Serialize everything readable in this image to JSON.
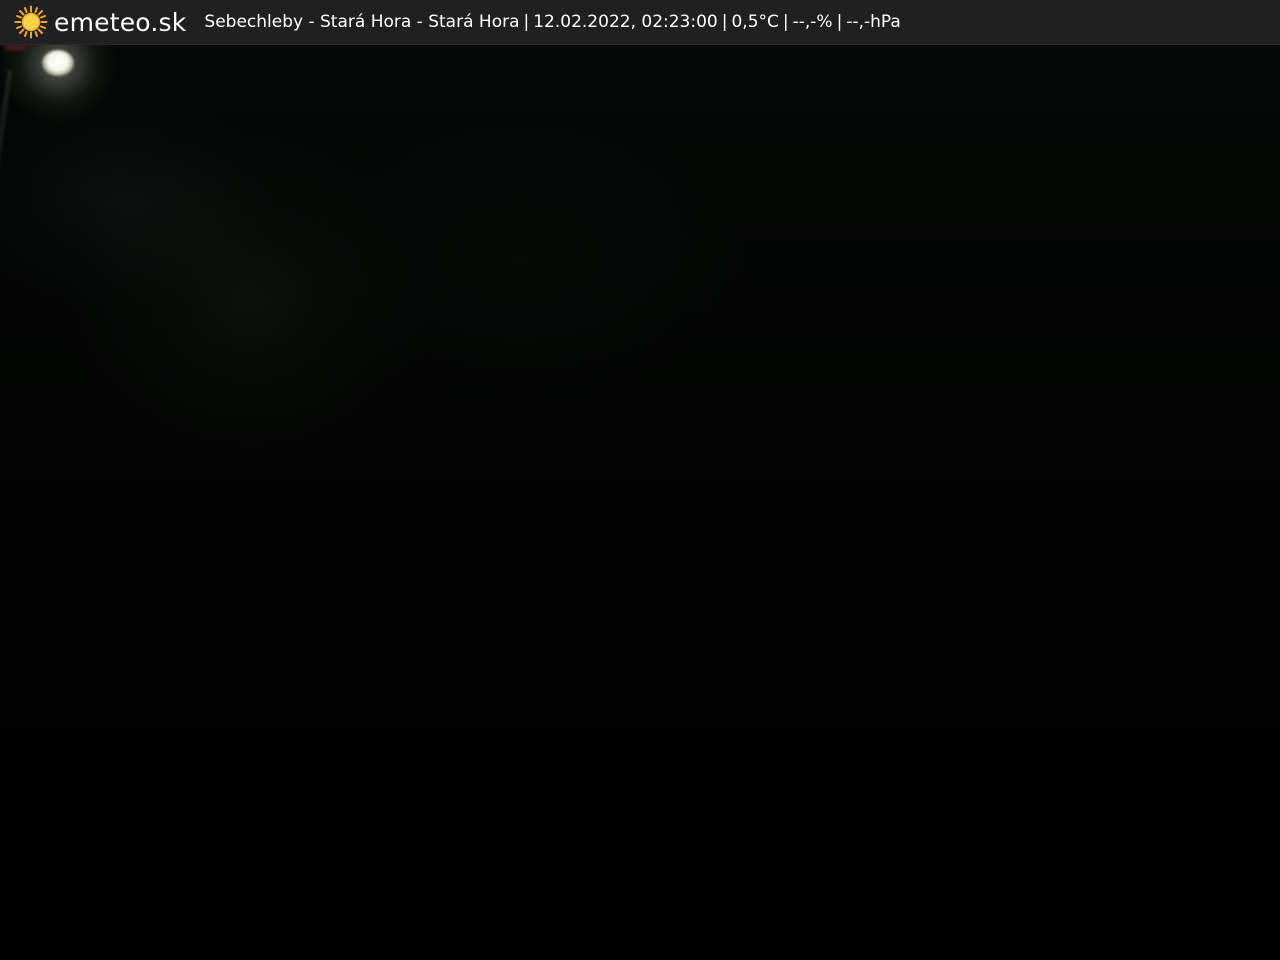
{
  "overlay": {
    "brand": "emeteo.sk",
    "location": "Sebechleby - Stará Hora - Stará Hora",
    "datetime": "12.02.2022, 02:23:00",
    "temperature": "0,5°C",
    "humidity": "--,-%",
    "pressure": "--,-hPa",
    "separator": "|",
    "logo_icon": "sun-icon"
  },
  "colors": {
    "bar_background": "#202020",
    "text": "#ffffff",
    "sun": "#f5a623",
    "scene": "#000000"
  }
}
